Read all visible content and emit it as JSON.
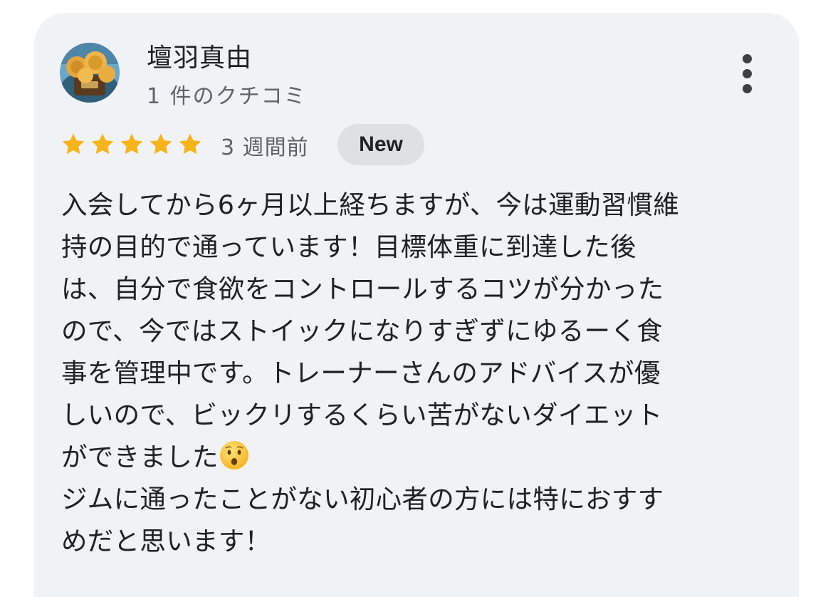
{
  "review": {
    "author": "壇羽真由",
    "review_count": "1 件のクチコミ",
    "rating": 5,
    "time_ago": "3 週間前",
    "badge": "New",
    "body_lines": [
      "入会してから6ヶ月以上経ちますが、今は運動習慣維",
      "持の目的で通っています！目標体重に到達した後",
      "は、自分で食欲をコントロールするコツが分かった",
      "ので、今ではストイックになりすぎずにゆるーく食",
      "事を管理中です。トレーナーさんのアドバイスが優",
      "しいので、ビックリするくらい苦がないダイエット",
      "ができました",
      "ジムに通ったことがない初心者の方には特におすす",
      "めだと思います！"
    ],
    "emoji_icon": "hushed-face-emoji"
  },
  "icons": {
    "avatar": "avatar-image",
    "more": "more-vert-icon",
    "star": "star-icon"
  },
  "colors": {
    "card_bg": "#f1f2f5",
    "star": "#f6b41a",
    "badge_bg": "#dee0e4",
    "text": "#202124",
    "secondary_text": "#5f6368"
  }
}
